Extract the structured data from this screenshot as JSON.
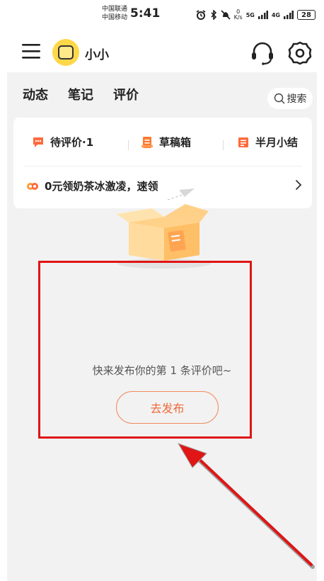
{
  "status_bar": {
    "carrier_1": "中国联通",
    "carrier_2": "中国移动",
    "time": "5:41",
    "net_speed_value": "0",
    "net_speed_unit": "K/s",
    "signal_5g": "5G",
    "signal_4g": "4G",
    "battery": "28"
  },
  "header": {
    "username": "小小",
    "icons": [
      "menu-icon",
      "avatar",
      "customer-service-icon",
      "settings-icon"
    ]
  },
  "tabs": [
    {
      "label": "动态",
      "active": false
    },
    {
      "label": "笔记",
      "active": false
    },
    {
      "label": "评价",
      "active": true
    }
  ],
  "search": {
    "label": "搜索"
  },
  "card": {
    "pending_review": "待评价·1",
    "drafts": "草稿箱",
    "half_month_summary": "半月小结",
    "promo": "0元领奶茶冰激凌，速领"
  },
  "empty_state": {
    "message": "快来发布你的第 1 条评价吧~",
    "publish_button": "去发布"
  },
  "colors": {
    "accent": "#f0693a",
    "annotation": "#e01515",
    "background": "#f2f2f2"
  }
}
